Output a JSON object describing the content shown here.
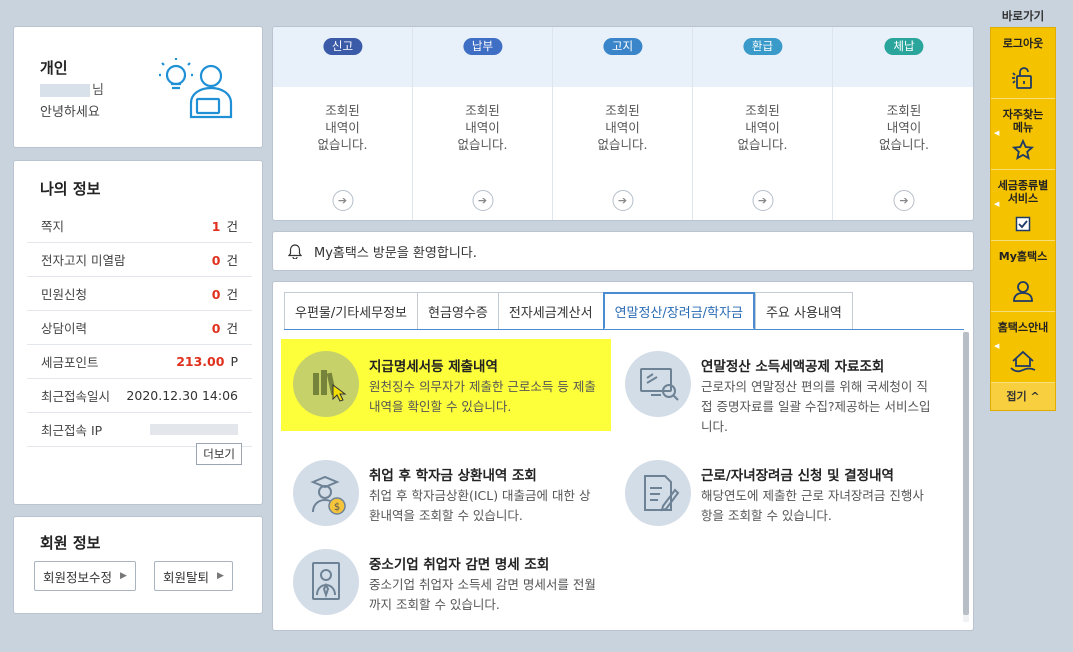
{
  "profile": {
    "kind": "개인",
    "name_suffix": "님",
    "greeting": "안녕하세요"
  },
  "my_info": {
    "title": "나의 정보",
    "rows": [
      {
        "label": "쪽지",
        "value": "1",
        "unit": "건"
      },
      {
        "label": "전자고지 미열람",
        "value": "0",
        "unit": "건"
      },
      {
        "label": "민원신청",
        "value": "0",
        "unit": "건"
      },
      {
        "label": "상담이력",
        "value": "0",
        "unit": "건"
      },
      {
        "label": "세금포인트",
        "value": "213.00",
        "unit": "P"
      },
      {
        "label": "최근접속일시",
        "value": "2020.12.30 14:06"
      },
      {
        "label": "최근접속 IP"
      }
    ],
    "more_label": "더보기"
  },
  "member": {
    "title": "회원 정보",
    "edit_label": "회원정보수정",
    "withdraw_label": "회원탈퇴"
  },
  "status": {
    "columns": [
      {
        "label": "신고",
        "color": "#3b5ba8",
        "message": "조회된\n내역이\n없습니다."
      },
      {
        "label": "납부",
        "color": "#3f6fc4",
        "message": "조회된\n내역이\n없습니다."
      },
      {
        "label": "고지",
        "color": "#3a84c9",
        "message": "조회된\n내역이\n없습니다."
      },
      {
        "label": "환급",
        "color": "#3a9ac9",
        "message": "조회된\n내역이\n없습니다."
      },
      {
        "label": "체납",
        "color": "#2aa59c",
        "message": "조회된\n내역이\n없습니다."
      }
    ],
    "go_glyph": "➔"
  },
  "welcome": {
    "text": "My홈택스 방문을 환영합니다."
  },
  "tabs": [
    {
      "label": "우편물/기타세무정보",
      "active": false
    },
    {
      "label": "현금영수증",
      "active": false
    },
    {
      "label": "전자세금계산서",
      "active": false
    },
    {
      "label": "연말정산/장려금/학자금",
      "active": true
    },
    {
      "label": "주요 사용내역",
      "active": false
    }
  ],
  "items": [
    {
      "icon": "books-icon",
      "title": "지급명세서등 제출내역",
      "desc": "원천징수 의무자가 제출한 근로소득 등 제출내역을 확인할 수 있습니다.",
      "highlighted": true
    },
    {
      "icon": "monitor-search-icon",
      "title": "연말정산 소득세액공제 자료조회",
      "desc": "근로자의 연말정산 편의를 위해 국세청이 직접 증명자료를 일괄 수집?제공하는 서비스입니다.",
      "highlighted": false
    },
    {
      "icon": "graduate-coin-icon",
      "title": "취업 후 학자금 상환내역 조회",
      "desc": "취업 후 학자금상환(ICL) 대출금에 대한 상환내역을 조회할 수 있습니다.",
      "highlighted": false
    },
    {
      "icon": "document-pen-icon",
      "title": "근로/자녀장려금 신청 및 결정내역",
      "desc": "해당연도에 제출한 근로 자녀장려금 진행사항을 조회할 수 있습니다.",
      "highlighted": false
    },
    {
      "icon": "worker-icon",
      "title": "중소기업 취업자 감면 명세 조회",
      "desc": "중소기업 취업자 소득세 감면 명세서를 전월까지 조회할 수 있습니다.",
      "highlighted": false
    }
  ],
  "quick_menu": {
    "title": "바로가기",
    "items": [
      {
        "label": "로그아웃",
        "icon": "unlock-icon"
      },
      {
        "label": "자주찾는\n메뉴",
        "icon": "star-icon"
      },
      {
        "label": "세금종류별\n서비스",
        "icon": "checkbox-icon"
      },
      {
        "label": "My홈택스",
        "icon": "user-icon"
      },
      {
        "label": "홈택스안내",
        "icon": "home-icon"
      }
    ],
    "fold_label": "접기 ^"
  },
  "colors": {
    "highlight": "#fcff3a",
    "accent": "#4b8bd2",
    "alert": "#e0301e",
    "quick_bg": "#f5c200"
  }
}
